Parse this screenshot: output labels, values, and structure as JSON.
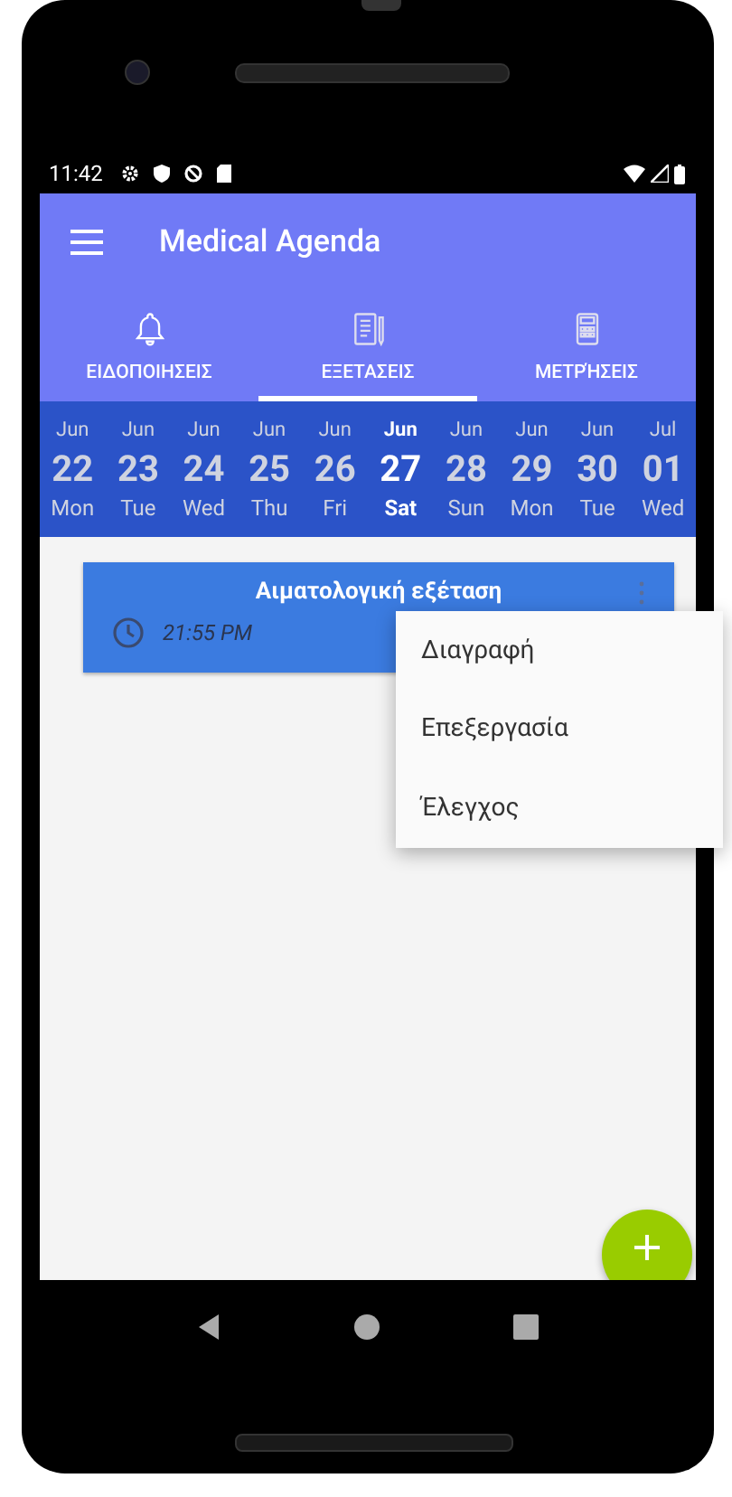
{
  "status_bar": {
    "time": "11:42"
  },
  "app_bar": {
    "title": "Medical Agenda"
  },
  "tabs": [
    {
      "label": "ΕΙΔΟΠΟΙΗΣΕΙΣ",
      "selected": false
    },
    {
      "label": "ΕΞΕΤΑΣΕΙΣ",
      "selected": true
    },
    {
      "label": "ΜΕΤΡΉΣΕΙΣ",
      "selected": false
    }
  ],
  "dates": [
    {
      "month": "Jun",
      "day": "22",
      "weekday": "Mon",
      "selected": false
    },
    {
      "month": "Jun",
      "day": "23",
      "weekday": "Tue",
      "selected": false
    },
    {
      "month": "Jun",
      "day": "24",
      "weekday": "Wed",
      "selected": false
    },
    {
      "month": "Jun",
      "day": "25",
      "weekday": "Thu",
      "selected": false
    },
    {
      "month": "Jun",
      "day": "26",
      "weekday": "Fri",
      "selected": false
    },
    {
      "month": "Jun",
      "day": "27",
      "weekday": "Sat",
      "selected": true
    },
    {
      "month": "Jun",
      "day": "28",
      "weekday": "Sun",
      "selected": false
    },
    {
      "month": "Jun",
      "day": "29",
      "weekday": "Mon",
      "selected": false
    },
    {
      "month": "Jun",
      "day": "30",
      "weekday": "Tue",
      "selected": false
    },
    {
      "month": "Jul",
      "day": "01",
      "weekday": "Wed",
      "selected": false
    }
  ],
  "events": [
    {
      "title": "Αιματολογική εξέταση",
      "time": "21:55 PM"
    }
  ],
  "context_menu": {
    "items": [
      "Διαγραφή",
      "Επεξεργασία",
      "Έλεγχος"
    ]
  }
}
